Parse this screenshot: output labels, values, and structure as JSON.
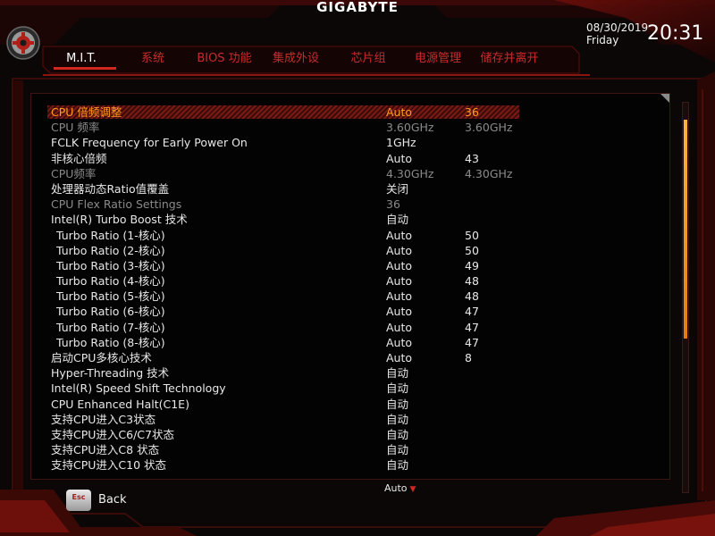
{
  "header": {
    "brand": "GIGABYTE",
    "date": "08/30/2019",
    "day": "Friday",
    "time": "20:31"
  },
  "tabs": [
    {
      "label": "M.I.T.",
      "active": true
    },
    {
      "label": "系统",
      "active": false
    },
    {
      "label": "BIOS 功能",
      "active": false
    },
    {
      "label": "集成外设",
      "active": false
    },
    {
      "label": "芯片组",
      "active": false
    },
    {
      "label": "电源管理",
      "active": false
    },
    {
      "label": "储存并离开",
      "active": false
    }
  ],
  "settings": [
    {
      "label": "CPU 倍频调整",
      "v1": "Auto",
      "v2": "36"
    },
    {
      "label": "CPU 频率",
      "v1": "3.60GHz",
      "v2": "3.60GHz"
    },
    {
      "label": "FCLK Frequency for Early Power On",
      "v1": "1GHz",
      "v2": ""
    },
    {
      "label": "非核心倍频",
      "v1": "Auto",
      "v2": "43"
    },
    {
      "label": "CPU频率",
      "v1": "4.30GHz",
      "v2": "4.30GHz"
    },
    {
      "label": "处理器动态Ratio值覆盖",
      "v1": "关闭",
      "v2": ""
    },
    {
      "label": "CPU Flex Ratio Settings",
      "v1": "36",
      "v2": ""
    },
    {
      "label": "Intel(R) Turbo Boost 技术",
      "v1": "自动",
      "v2": ""
    },
    {
      "label": "Turbo Ratio (1-核心)",
      "v1": "Auto",
      "v2": "50"
    },
    {
      "label": "Turbo Ratio (2-核心)",
      "v1": "Auto",
      "v2": "50"
    },
    {
      "label": "Turbo Ratio (3-核心)",
      "v1": "Auto",
      "v2": "49"
    },
    {
      "label": "Turbo Ratio (4-核心)",
      "v1": "Auto",
      "v2": "48"
    },
    {
      "label": "Turbo Ratio (5-核心)",
      "v1": "Auto",
      "v2": "48"
    },
    {
      "label": "Turbo Ratio (6-核心)",
      "v1": "Auto",
      "v2": "47"
    },
    {
      "label": "Turbo Ratio (7-核心)",
      "v1": "Auto",
      "v2": "47"
    },
    {
      "label": "Turbo Ratio (8-核心)",
      "v1": "Auto",
      "v2": "47"
    },
    {
      "label": "启动CPU多核心技术",
      "v1": "Auto",
      "v2": "8"
    },
    {
      "label": "Hyper-Threading 技术",
      "v1": "自动",
      "v2": ""
    },
    {
      "label": "Intel(R) Speed Shift Technology",
      "v1": "自动",
      "v2": ""
    },
    {
      "label": "CPU Enhanced Halt(C1E)",
      "v1": "自动",
      "v2": ""
    },
    {
      "label": "支持CPU进入C3状态",
      "v1": "自动",
      "v2": ""
    },
    {
      "label": "支持CPU进入C6/C7状态",
      "v1": "自动",
      "v2": ""
    },
    {
      "label": "支持CPU进入C8 状态",
      "v1": "自动",
      "v2": ""
    },
    {
      "label": "支持CPU进入C10 状态",
      "v1": "自动",
      "v2": ""
    }
  ],
  "footer": {
    "scroll_hint": "Auto",
    "esc_key": "Esc",
    "back_label": "Back"
  },
  "colors": {
    "accent": "#d0281e",
    "selected_text": "#ff9b1e",
    "dim_text": "#8a8a8a",
    "scroll_thumb": "#ffb43a"
  },
  "icons": [
    "gear-icon",
    "triangle-down-icon",
    "esc-key-icon"
  ]
}
